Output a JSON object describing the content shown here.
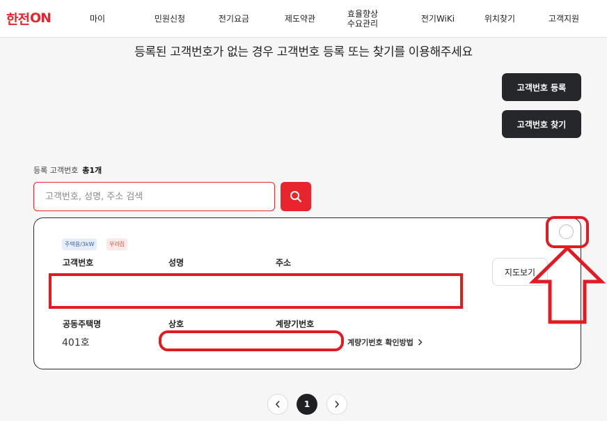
{
  "logo": {
    "part1": "한전",
    "part2": "ON"
  },
  "nav": [
    {
      "label": "마이"
    },
    {
      "label": "민원신청"
    },
    {
      "label": "전기요금"
    },
    {
      "label": "제도약관"
    },
    {
      "label_line1": "효율향상",
      "label_line2": "수요관리"
    },
    {
      "label": "전기WiKi"
    },
    {
      "label": "위치찾기"
    },
    {
      "label": "고객지원"
    }
  ],
  "headline": "등록된 고객번호가 없는 경우 고객번호 등록 또는 찾기를 이용해주세요",
  "actions": {
    "register_label": "고객번호 등록",
    "find_label": "고객번호 찾기"
  },
  "list": {
    "label": "등록 고객번호",
    "count": "총1개"
  },
  "search": {
    "placeholder": "고객번호, 성명, 주소 검색",
    "value": ""
  },
  "card": {
    "badge_type": "주택용/3kW",
    "badge_home": "우리집",
    "labels": {
      "customer_no": "고객번호",
      "name": "성명",
      "address": "주소",
      "apartment": "공동주택명",
      "business": "상호",
      "meter_no": "계량기번호"
    },
    "values": {
      "apartment": "401호"
    },
    "map_label": "지도보기",
    "meter_help": "계량기번호 확인방법"
  },
  "pagination": {
    "current": "1"
  },
  "colors": {
    "brand": "#e8242c",
    "dark_button": "#26272b",
    "annotation": "#e11b22"
  }
}
